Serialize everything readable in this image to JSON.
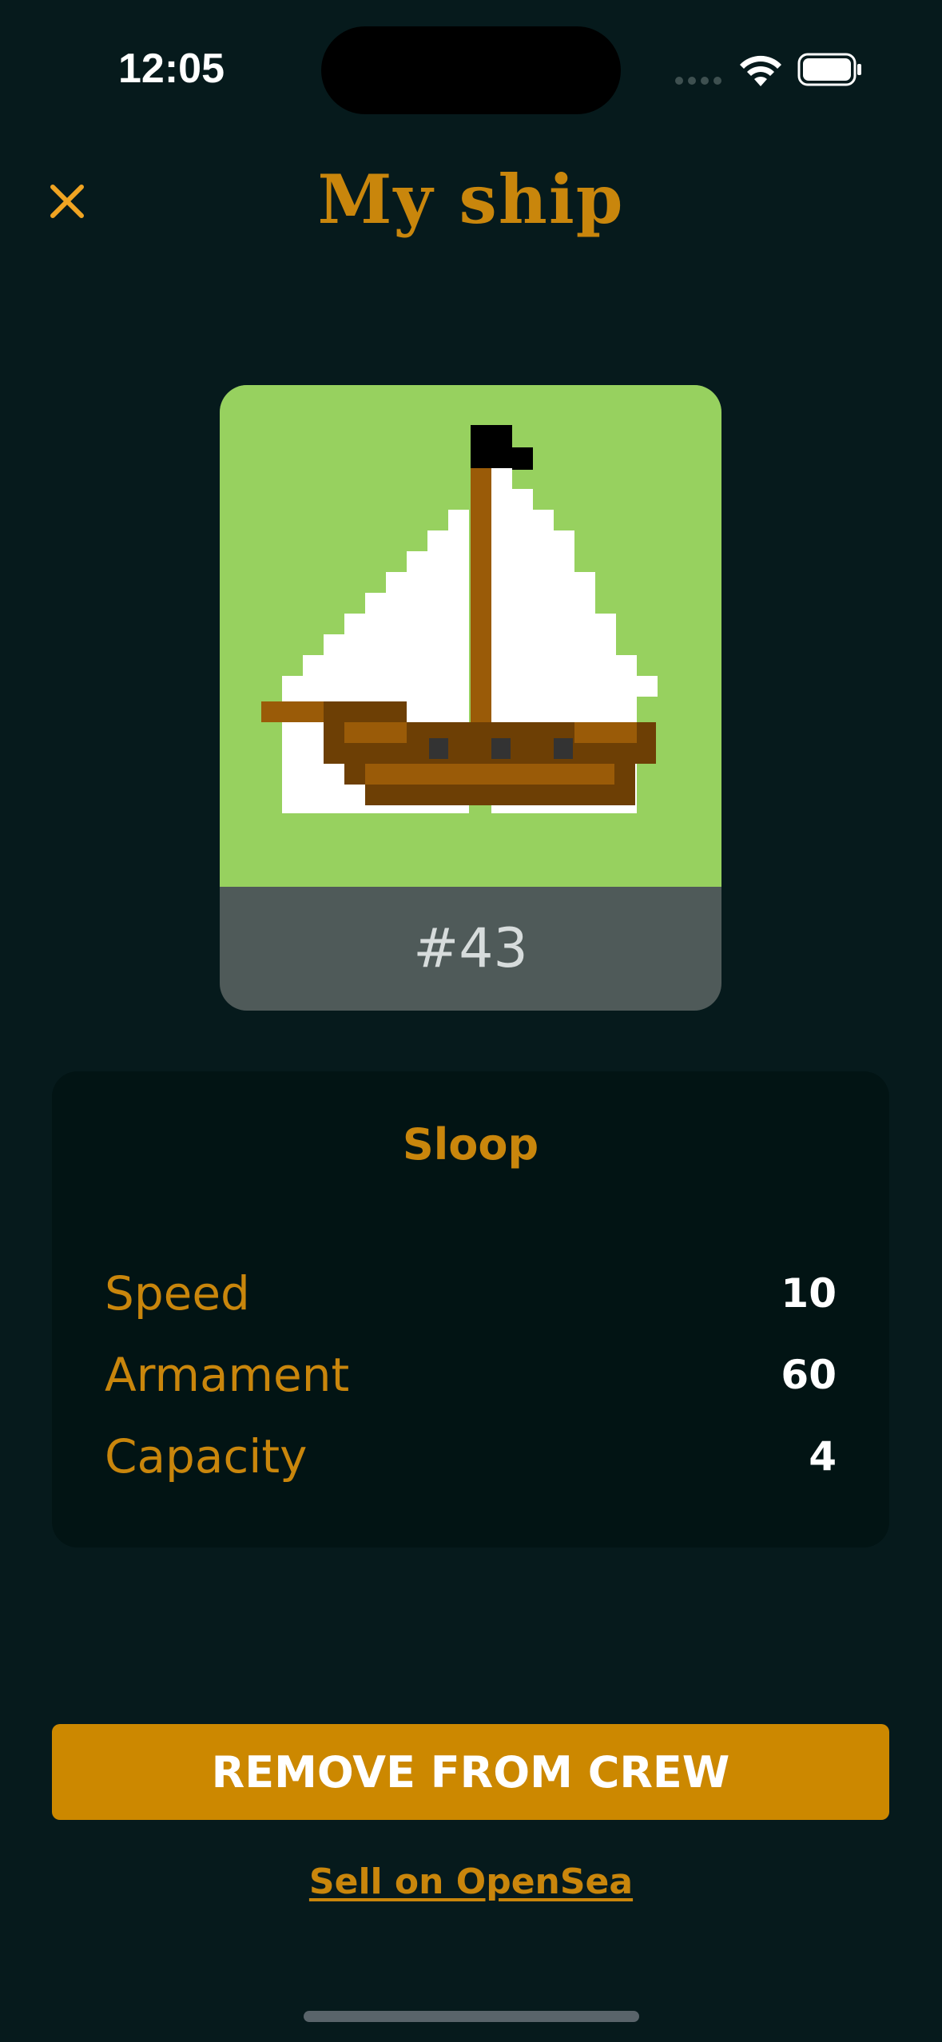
{
  "status_bar": {
    "time": "12:05"
  },
  "header": {
    "title": "My ship",
    "close_icon": "close-icon"
  },
  "ship": {
    "number": "#43",
    "type": "Sloop",
    "image_background": "#97d15f",
    "stats": [
      {
        "label": "Speed",
        "value": "10"
      },
      {
        "label": "Armament",
        "value": "60"
      },
      {
        "label": "Capacity",
        "value": "4"
      }
    ]
  },
  "actions": {
    "remove_label": "REMOVE FROM CREW",
    "sell_label": "Sell on OpenSea"
  },
  "colors": {
    "background": "#061a1c",
    "accent": "#c9860c",
    "button": "#cc8800",
    "panel": "#021414"
  }
}
